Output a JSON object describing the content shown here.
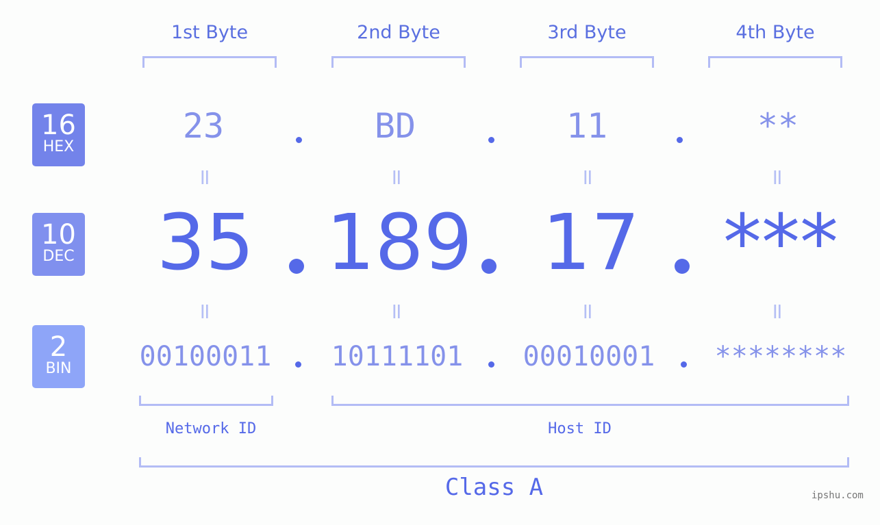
{
  "byte_headers": [
    "1st Byte",
    "2nd Byte",
    "3rd Byte",
    "4th Byte"
  ],
  "badges": [
    {
      "num": "16",
      "label": "HEX",
      "color": "#7383ea"
    },
    {
      "num": "10",
      "label": "DEC",
      "color": "#8090ee"
    },
    {
      "num": "2",
      "label": "BIN",
      "color": "#8ea5f8"
    }
  ],
  "hex": [
    "23",
    "BD",
    "11",
    "**"
  ],
  "dec": [
    "35",
    "189",
    "17",
    "***"
  ],
  "bin": [
    "00100011",
    "10111101",
    "00010001",
    "********"
  ],
  "separator": ".",
  "equals": "=",
  "sections": {
    "network": "Network ID",
    "host": "Host ID",
    "class": "Class A"
  },
  "watermark": "ipshu.com",
  "colors": {
    "primary": "#5569e8",
    "light": "#8592ea",
    "bracket": "#b3bcf5"
  }
}
